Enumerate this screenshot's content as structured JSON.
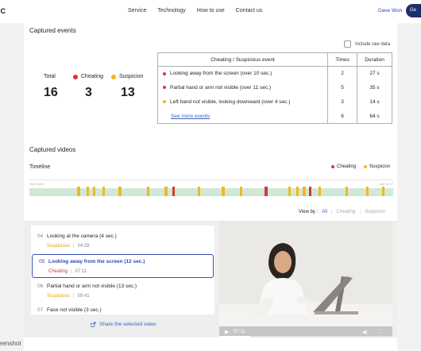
{
  "nav": {
    "logo": "IC",
    "links": [
      "Service",
      "Technology",
      "How to use",
      "Contact us"
    ],
    "user": "Dave Won",
    "button": "Ge"
  },
  "captured_events": {
    "title": "Captured events",
    "raw_label": "Include raw data",
    "stats": [
      {
        "label": "Total",
        "value": "16"
      },
      {
        "label": "Cheating",
        "value": "3",
        "color": "#d93636"
      },
      {
        "label": "Suspicion",
        "value": "13",
        "color": "#f2b81c"
      }
    ],
    "table": {
      "headers": [
        "Cheating / Suspicious event",
        "Times",
        "Duration"
      ],
      "rows": [
        {
          "event": "Looking away from the screen (over 10 sec.)",
          "times": "2",
          "duration": "27 s",
          "color": "#d93636"
        },
        {
          "event": "Partial hand or arm not visible (over 11 sec.)",
          "times": "5",
          "duration": "35 s",
          "color": "#d93636"
        },
        {
          "event": "Left hand not visible, looking downward (over 4 sec.)",
          "times": "3",
          "duration": "14 s",
          "color": "#f2b81c"
        }
      ],
      "see_more": "See more events",
      "see_more_times": "6",
      "see_more_duration": "64 s"
    }
  },
  "captured_videos": {
    "title": "Captured videos",
    "timeline_label": "Timeline",
    "legend": [
      {
        "label": "Cheating",
        "color": "#d93636"
      },
      {
        "label": "Suspicion",
        "color": "#f2b81c"
      }
    ],
    "ticks": [
      "AM 10:00",
      "AM 12:17"
    ],
    "view_by_label": "View by :",
    "view_options": [
      "All",
      "Cheating",
      "Suspicion"
    ],
    "items": [
      {
        "num": "04",
        "title": "Looking at the camera (4 sec.)",
        "tag": "Suspicious",
        "tag_color": "#e0a800",
        "time": "04:28"
      },
      {
        "num": "05",
        "title": "Looking away from the screen (12 sec.)",
        "tag": "Cheating",
        "tag_color": "#d93636",
        "time": "07:11"
      },
      {
        "num": "06",
        "title": "Partial hand or arm not visible (13 sec.)",
        "tag": "Suspicious",
        "tag_color": "#e0a800",
        "time": "09:41"
      },
      {
        "num": "07",
        "title": "Face not visible  (3 sec.)",
        "tag": "",
        "tag_color": "#e0a800",
        "time": ""
      }
    ],
    "share": "Share the selected video",
    "video_time": "07:11",
    "video_progress": 0.18
  },
  "footer_label": "eenshot"
}
